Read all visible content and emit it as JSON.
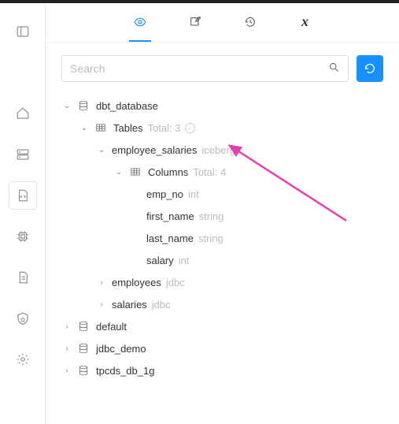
{
  "search": {
    "placeholder": "Search"
  },
  "tree": {
    "databases": [
      {
        "name": "dbt_database",
        "expanded": true,
        "tablesLabel": "Tables",
        "tablesMeta": "Total: 3",
        "tables": [
          {
            "name": "employee_salaries",
            "engine": "iceberg",
            "expanded": true,
            "columnsLabel": "Columns",
            "columnsMeta": "Total: 4",
            "columns": [
              {
                "name": "emp_no",
                "type": "int"
              },
              {
                "name": "first_name",
                "type": "string"
              },
              {
                "name": "last_name",
                "type": "string"
              },
              {
                "name": "salary",
                "type": "int"
              }
            ]
          },
          {
            "name": "employees",
            "engine": "jdbc",
            "expanded": false
          },
          {
            "name": "salaries",
            "engine": "jdbc",
            "expanded": false
          }
        ]
      },
      {
        "name": "default",
        "expanded": false
      },
      {
        "name": "jdbc_demo",
        "expanded": false
      },
      {
        "name": "tpcds_db_1g",
        "expanded": false
      }
    ]
  }
}
